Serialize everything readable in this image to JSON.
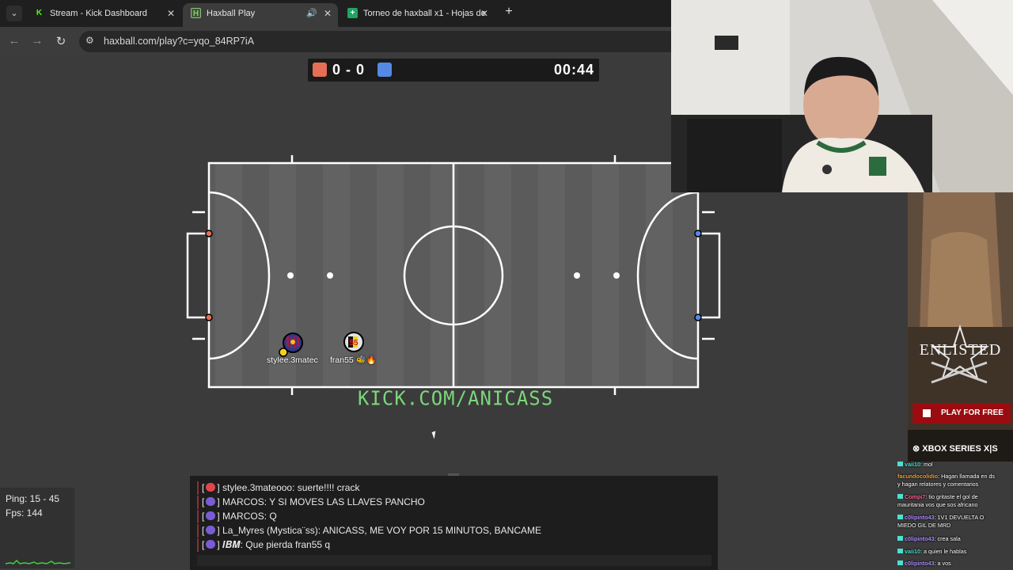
{
  "browser": {
    "tabs": [
      {
        "title": "Stream - Kick Dashboard",
        "icon": "kick-icon",
        "color": "#53fc18"
      },
      {
        "title": "Haxball Play",
        "icon": "haxball-icon",
        "color": "#8ec07c"
      },
      {
        "title": "Torneo de haxball x1 - Hojas de",
        "icon": "sheets-icon",
        "color": "#1fa463"
      }
    ],
    "url": "haxball.com/play?c=yqo_84RP7iA"
  },
  "game": {
    "score": "0 - 0",
    "time": "00:44",
    "red_team_color": "#e56e56",
    "blue_team_color": "#5689e5",
    "players": [
      {
        "name": "stylee.3matec",
        "team": "blue",
        "avatar": "barcelona-crest"
      },
      {
        "name": "fran55 🐝🔥",
        "team": "red",
        "avatar": "55"
      }
    ],
    "watermark": "KICK.COM/ANICASS"
  },
  "stats": {
    "ping": "Ping: 15 - 45",
    "fps": "Fps: 144"
  },
  "chat": {
    "messages": [
      {
        "prefix": "[",
        "suffix": "]",
        "text": "stylee.3mateooo: suerte!!!! crack",
        "icon": "red-dot"
      },
      {
        "prefix": "[",
        "suffix": "]",
        "text": "MARCOS: Y SI MOVES LAS LLAVES PANCHO",
        "icon": "purple-user"
      },
      {
        "prefix": "[",
        "suffix": "]",
        "text": "MARCOS: Q",
        "icon": "purple-user"
      },
      {
        "prefix": "[",
        "suffix": "]",
        "text": "La_Myres (Mystica¨ss): ANICASS, ME VOY POR 15 MINUTOS, BANCAME",
        "icon": "purple-user"
      },
      {
        "prefix": "[",
        "suffix": "]",
        "text": "𝑰𝑩𝑴: Que pierda fran55 q",
        "icon": "purple-user"
      }
    ]
  },
  "ad": {
    "title": "ENLISTED",
    "cta": "PLAY FOR FREE",
    "platforms": "XBOX SERIES X|S"
  },
  "stream_chat": [
    {
      "user": "vaii10",
      "text": ": mol",
      "color": "#4be0d0"
    },
    {
      "user": "facundocolidio",
      "text": ": Hagan llamada en ds",
      "color": "#f2a13c"
    },
    {
      "user": "",
      "text": "y hagan relatores y comentarios",
      "color": "#ffffff"
    },
    {
      "user": "Compi7",
      "text": ": tio gritaste el gol de",
      "color": "#ff5f8f"
    },
    {
      "user": "",
      "text": "mauritania vos que sos africano",
      "color": "#ffffff"
    },
    {
      "user": "c0lipinto43",
      "text": ": 1V1 DEVUELTA O",
      "color": "#b18cff"
    },
    {
      "user": "",
      "text": "MIEDO GIL DE MRD",
      "color": "#ffffff"
    },
    {
      "user": "c0lipinto43",
      "text": ": crea sala",
      "color": "#b18cff"
    },
    {
      "user": "vaii10",
      "text": ": a quien le hablas",
      "color": "#4be0d0"
    },
    {
      "user": "c0lipinto43",
      "text": ": a vos",
      "color": "#b18cff"
    }
  ]
}
